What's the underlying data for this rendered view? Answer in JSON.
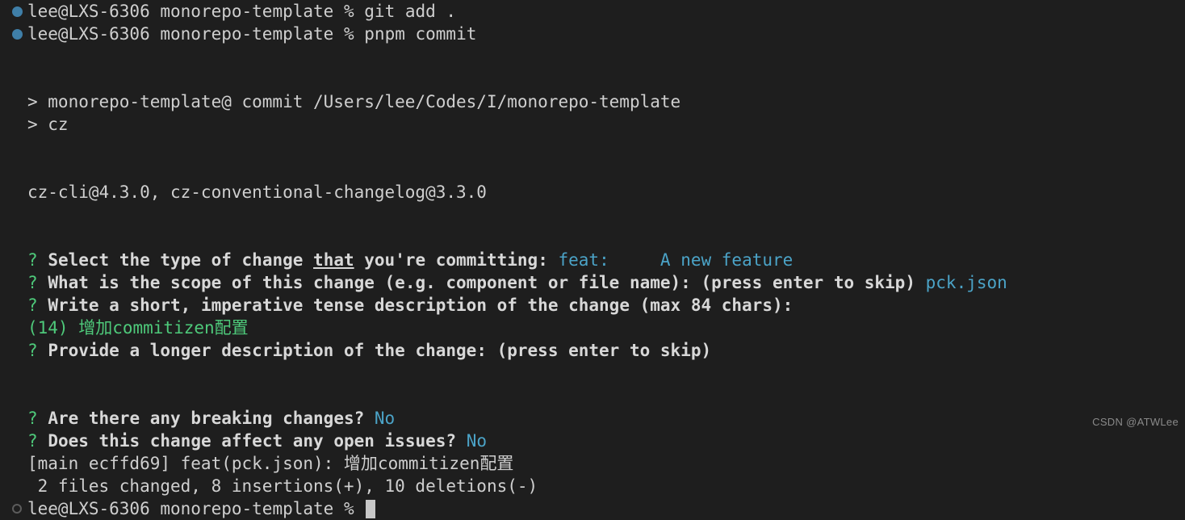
{
  "terminal": {
    "background_color": "#1e1e1e",
    "foreground_color": "#d4d4d4",
    "accent_colors": {
      "prompt_bullet_done": "#3f7fa8",
      "prompt_bullet_active": "#5c5c5c",
      "question_mark": "#4ec97a",
      "answer": "#4ba3c7",
      "input_echo": "#4ec97a",
      "cursor": "#c8c8c8"
    },
    "shell_user_host": "lee@LXS-6306",
    "shell_cwd": "monorepo-template",
    "shell_sigil": "%"
  },
  "lines": {
    "cmd_git_add": "git add .",
    "cmd_pnpm_commit": "pnpm commit",
    "npm_script_header": "> monorepo-template@ commit /Users/lee/Codes/I/monorepo-template",
    "npm_script_cmd": "> cz",
    "cz_version": "cz-cli@4.3.0, cz-conventional-changelog@3.3.0",
    "q_mark": "?",
    "q_type_a": "Select the type of change ",
    "q_type_underlined": "that",
    "q_type_b": " you're committing:",
    "a_type": "feat:     A new feature",
    "q_scope": "What is the scope of this change (e.g. component or file name): (press enter to skip)",
    "a_scope": "pck.json",
    "q_short_desc": "Write a short, imperative tense description of the change (max 84 chars):",
    "a_short_desc": "(14) 增加commitizen配置",
    "q_long_desc": "Provide a longer description of the change: (press enter to skip)",
    "q_breaking": "Are there any breaking changes?",
    "a_breaking": "No",
    "q_issues": "Does this change affect any open issues?",
    "a_issues": "No",
    "git_commit_summary": "[main ecffd69] feat(pck.json): 增加commitizen配置",
    "git_commit_stats": " 2 files changed, 8 insertions(+), 10 deletions(-)"
  },
  "watermark": {
    "text": "CSDN @ATWLee"
  }
}
